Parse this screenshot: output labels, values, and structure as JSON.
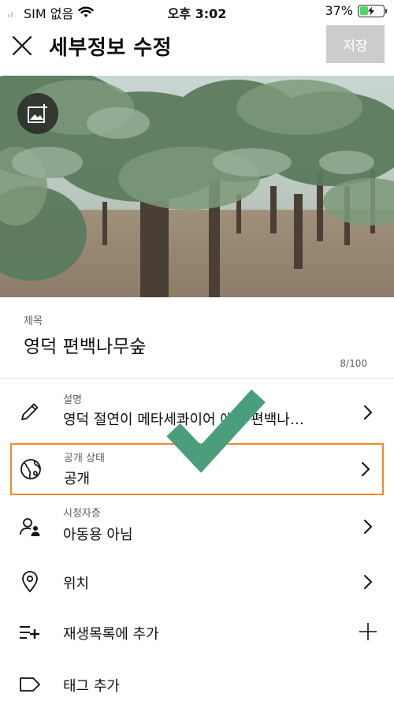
{
  "status_bar": {
    "carrier": "SIM 없음",
    "time": "오후 3:02",
    "battery_percent": "37%",
    "battery_level": 0.37,
    "battery_color": "#4cd964"
  },
  "header": {
    "title": "세부정보 수정",
    "save_label": "저장",
    "close_icon": "close-icon"
  },
  "thumbnail": {
    "change_image_icon": "add-photo-icon"
  },
  "video_title": {
    "label": "제목",
    "value": "영덕 편백나무숲",
    "counter": "8/100"
  },
  "rows": {
    "description": {
      "label": "설명",
      "value": "영덕 절연이 메타세콰이어 에는 편백나…",
      "icon": "pencil-icon"
    },
    "privacy": {
      "label": "공개 상태",
      "value": "공개",
      "icon": "globe-icon",
      "highlight_color": "#f0892b"
    },
    "audience": {
      "label": "시청자층",
      "value": "아동용 아님",
      "icon": "audience-icon"
    },
    "location": {
      "value": "위치",
      "icon": "location-pin-icon"
    },
    "playlist": {
      "value": "재생목록에 추가",
      "icon": "playlist-add-icon"
    },
    "tags": {
      "value": "태그 추가",
      "icon": "tag-icon"
    }
  },
  "overlay": {
    "checkmark_color": "#4a9e7e"
  }
}
